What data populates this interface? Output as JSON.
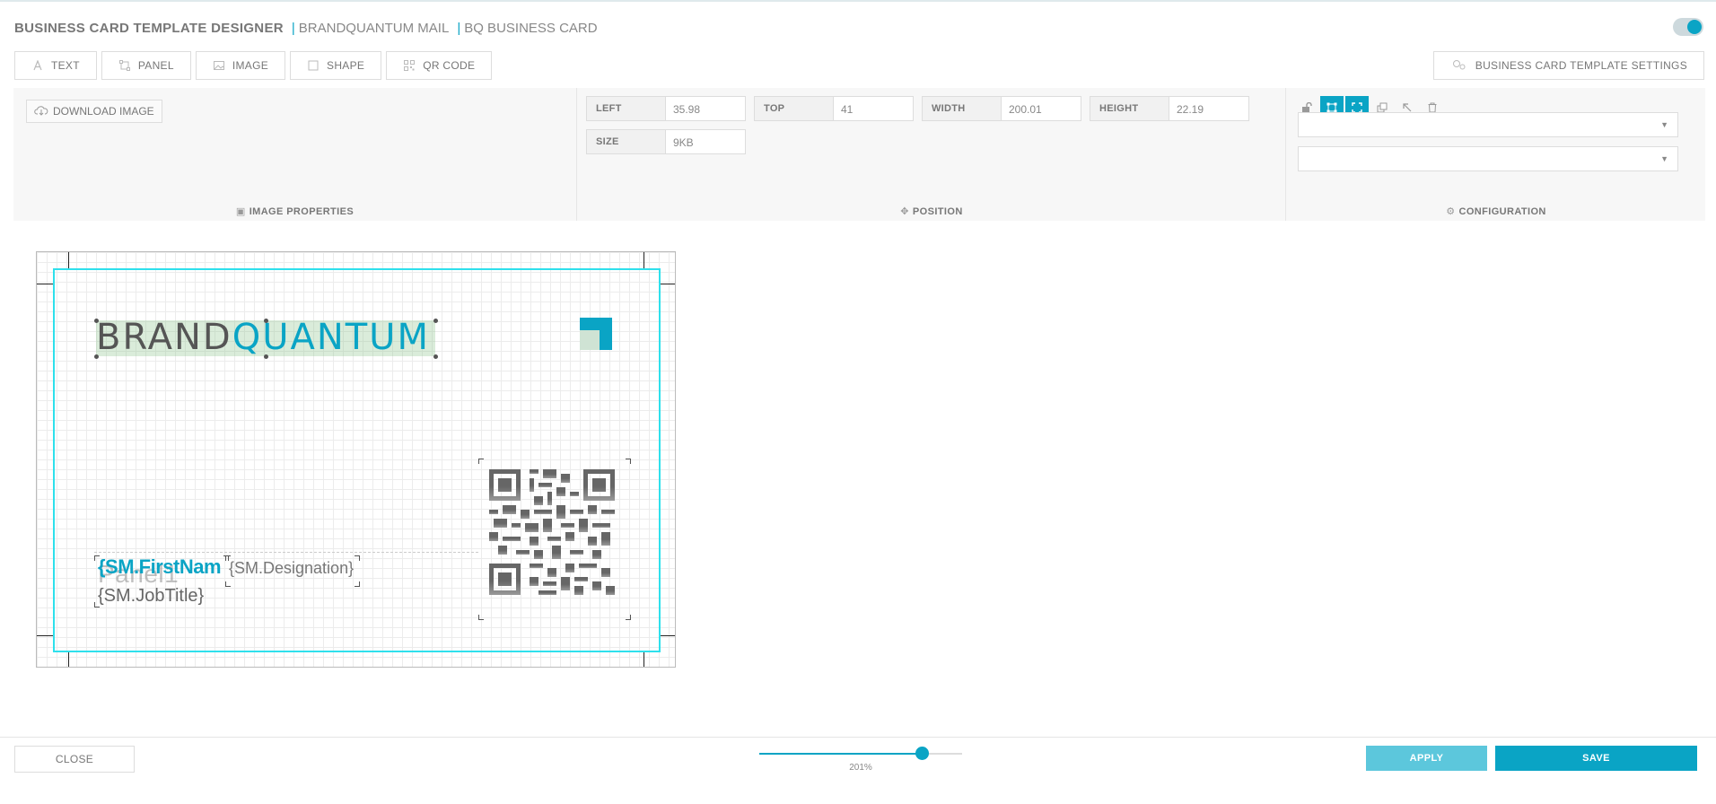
{
  "header": {
    "app_title": "BUSINESS CARD TEMPLATE DESIGNER",
    "breadcrumbs": [
      "BRANDQUANTUM MAIL",
      "BQ BUSINESS CARD"
    ]
  },
  "toolbar": {
    "items": [
      {
        "label": "TEXT",
        "icon": "text-icon"
      },
      {
        "label": "PANEL",
        "icon": "panel-icon"
      },
      {
        "label": "IMAGE",
        "icon": "image-icon"
      },
      {
        "label": "SHAPE",
        "icon": "shape-icon"
      },
      {
        "label": "QR CODE",
        "icon": "qr-code-icon"
      }
    ],
    "settings_label": "BUSINESS CARD TEMPLATE SETTINGS"
  },
  "image_properties": {
    "download_label": "DOWNLOAD IMAGE",
    "section_label": "IMAGE PROPERTIES"
  },
  "position": {
    "section_label": "POSITION",
    "fields": {
      "left": {
        "label": "LEFT",
        "value": "35.98"
      },
      "top": {
        "label": "TOP",
        "value": "41"
      },
      "width": {
        "label": "WIDTH",
        "value": "200.01"
      },
      "height": {
        "label": "HEIGHT",
        "value": "22.19"
      },
      "size": {
        "label": "SIZE",
        "value": "9KB"
      }
    }
  },
  "configuration": {
    "section_label": "CONFIGURATION",
    "icons": [
      "lock-open-icon",
      "transform-icon",
      "fit-icon",
      "duplicate-icon",
      "arrow-up-left-icon",
      "trash-icon"
    ],
    "select_1": "",
    "select_2": ""
  },
  "card": {
    "logo_part1": "BRAND",
    "logo_part2": "QUANTUM",
    "first_name": "{SM.FirstNam",
    "panel_text": "Panel1",
    "designation": "{SM.Designation}",
    "job_title": "{SM.JobTitle}"
  },
  "footer": {
    "close_label": "CLOSE",
    "zoom_label": "201%",
    "zoom_fraction": 0.8,
    "apply_label": "APPLY",
    "save_label": "SAVE"
  },
  "colors": {
    "accent": "#0aa4c5",
    "card_border": "#2ee0ec"
  }
}
